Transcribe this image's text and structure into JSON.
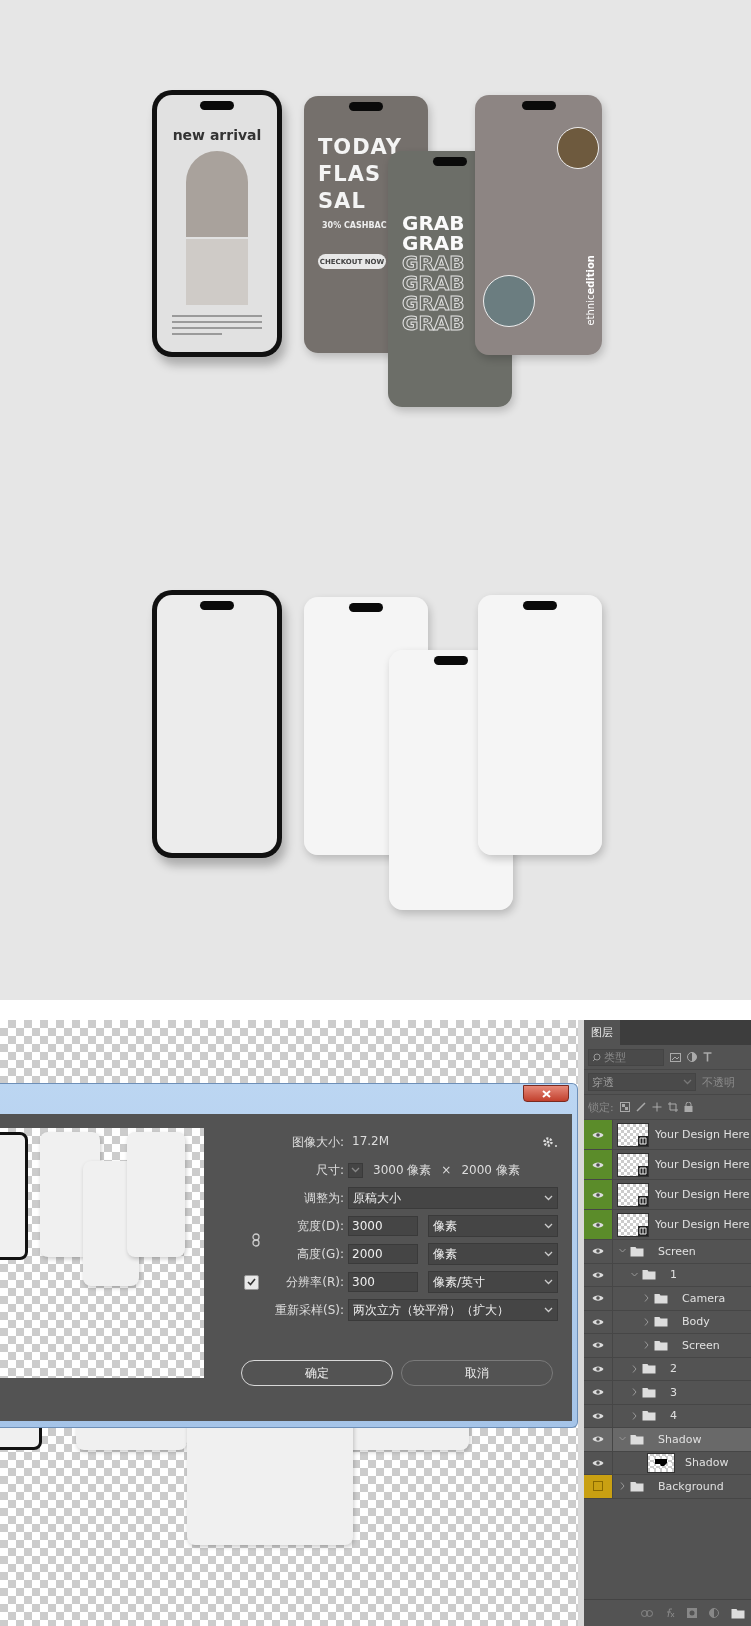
{
  "mockup_showcase": {
    "screens": [
      {
        "kind": "arrival",
        "title": "new arrival"
      },
      {
        "kind": "sale",
        "lines": [
          "TODAY",
          "FLAS",
          "SAL"
        ],
        "cashback": "30% CASHBAC",
        "button": "CHECKOUT NOW"
      },
      {
        "kind": "grab",
        "words": [
          {
            "text": "GRAB",
            "kind": "solid"
          },
          {
            "text": "GRAB",
            "kind": "solid"
          },
          {
            "text": "GRAB",
            "kind": "outline"
          },
          {
            "text": "GRAB",
            "kind": "outline"
          },
          {
            "text": "GRAB",
            "kind": "outline"
          },
          {
            "text": "GRAB",
            "kind": "outline"
          }
        ]
      },
      {
        "kind": "ethnic",
        "brand": "ethnic**edition**"
      }
    ]
  },
  "image_size_dialog": {
    "size_label": "图像大小:",
    "size_value": "17.2M",
    "dimensions_label": "尺寸:",
    "dimensions_width": "3000 像素",
    "dimensions_times": "×",
    "dimensions_height": "2000 像素",
    "fit_to": {
      "label": "调整为:",
      "value": "原稿大小"
    },
    "fields": [
      {
        "label": "宽度(D):",
        "value": "3000",
        "unit": "像素"
      },
      {
        "label": "高度(G):",
        "value": "2000",
        "unit": "像素"
      },
      {
        "label": "分辨率(R):",
        "value": "300",
        "unit": "像素/英寸"
      }
    ],
    "resample": {
      "label": "重新采样(S):",
      "checked": true,
      "value": "两次立方（较平滑）（扩大）"
    },
    "buttons": [
      {
        "label": "确定",
        "default": true
      },
      {
        "label": "取消",
        "default": false
      }
    ]
  },
  "layers_panel": {
    "tabs": [
      {
        "label": "图层",
        "selected": true
      }
    ],
    "filter": {
      "placeholder": "类型"
    },
    "blend_mode": "穿透",
    "opacity_label": "不透明",
    "lock_label": "锁定:",
    "layers": [
      {
        "name": "Your Design Here",
        "kind": "smart_object",
        "visible": true,
        "selected": false,
        "color": "#5b8c2a"
      },
      {
        "name": "Your Design Here",
        "kind": "smart_object",
        "visible": true,
        "selected": false,
        "color": "#5b8c2a"
      },
      {
        "name": "Your Design Here",
        "kind": "smart_object",
        "visible": true,
        "selected": false,
        "color": "#5b8c2a"
      },
      {
        "name": "Your Design Here",
        "kind": "smart_object",
        "visible": true,
        "selected": false,
        "color": "#5b8c2a"
      },
      {
        "name": "Screen",
        "kind": "group",
        "visible": true,
        "selected": false,
        "expanded": true,
        "children": [
          {
            "name": "1",
            "kind": "group",
            "visible": true,
            "selected": false,
            "expanded": true,
            "children": [
              {
                "name": "Camera",
                "kind": "group",
                "visible": true,
                "selected": false,
                "expanded": false
              },
              {
                "name": "Body",
                "kind": "group",
                "visible": true,
                "selected": false,
                "expanded": false
              },
              {
                "name": "Screen",
                "kind": "group",
                "visible": true,
                "selected": false,
                "expanded": false
              }
            ]
          },
          {
            "name": "2",
            "kind": "group",
            "visible": true,
            "selected": false,
            "expanded": false
          },
          {
            "name": "3",
            "kind": "group",
            "visible": true,
            "selected": false,
            "expanded": false
          },
          {
            "name": "4",
            "kind": "group",
            "visible": true,
            "selected": false,
            "expanded": false
          }
        ]
      },
      {
        "name": "Shadow",
        "kind": "group",
        "visible": true,
        "selected": true,
        "expanded": true,
        "children": [
          {
            "name": "Shadow",
            "kind": "pixel_layer",
            "visible": true,
            "selected": false
          }
        ]
      },
      {
        "name": "Background",
        "kind": "group",
        "visible": false,
        "selected": false,
        "expanded": false,
        "color": "#c9a012"
      }
    ]
  }
}
